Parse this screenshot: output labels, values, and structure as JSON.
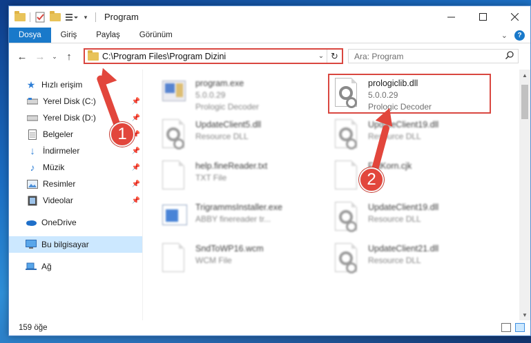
{
  "window": {
    "title": "Program"
  },
  "ribbon": {
    "tabs": [
      "Dosya",
      "Giriş",
      "Paylaş",
      "Görünüm"
    ]
  },
  "nav": {
    "address": "C:\\Program Files\\Program Dizini",
    "search_placeholder": "Ara: Program"
  },
  "sidebar": {
    "quick_access": "Hızlı erişim",
    "items": [
      {
        "label": "Yerel Disk (C:)",
        "icon": "drive-icon"
      },
      {
        "label": "Yerel Disk (D:)",
        "icon": "drive-icon"
      },
      {
        "label": "Belgeler",
        "icon": "documents-icon"
      },
      {
        "label": "İndirmeler",
        "icon": "download-icon"
      },
      {
        "label": "Müzik",
        "icon": "music-icon"
      },
      {
        "label": "Resimler",
        "icon": "pictures-icon"
      },
      {
        "label": "Videolar",
        "icon": "videos-icon"
      }
    ],
    "onedrive": "OneDrive",
    "this_pc": "Bu bilgisayar",
    "network": "Ağ"
  },
  "files": [
    {
      "name": "program.exe",
      "line2": "5.0.0.29",
      "line3": "Prologic Decoder",
      "icon": "exe"
    },
    {
      "name": "prologiclib.dll",
      "line2": "5.0.0.29",
      "line3": "Prologic Decoder",
      "icon": "dll"
    },
    {
      "name": "UpdateClient5.dll",
      "line2": "Resource DLL",
      "icon": "dll"
    },
    {
      "name": "UpdateClient19.dll",
      "line2": "Resource DLL",
      "icon": "dll"
    },
    {
      "name": "help.fineReader.txt",
      "line2": "TXT File",
      "icon": "txt"
    },
    {
      "name": "FntKorn.cjk",
      "line2": "File",
      "icon": "txt"
    },
    {
      "name": "TrigrammsInstaller.exe",
      "line2": "ABBY finereader tr...",
      "icon": "setup"
    },
    {
      "name": "UpdateClient19.dll",
      "line2": "Resource DLL",
      "icon": "dll"
    },
    {
      "name": "SndToWP16.wcm",
      "line2": "WCM File",
      "icon": "txt"
    },
    {
      "name": "UpdateClient21.dll",
      "line2": "Resource DLL",
      "icon": "dll"
    }
  ],
  "annotations": {
    "badge1": "1",
    "badge2": "2"
  },
  "status": {
    "count": "159 öğe"
  },
  "colors": {
    "accent": "#1979ca",
    "highlight": "#d9463f",
    "selection": "#cce8ff"
  }
}
